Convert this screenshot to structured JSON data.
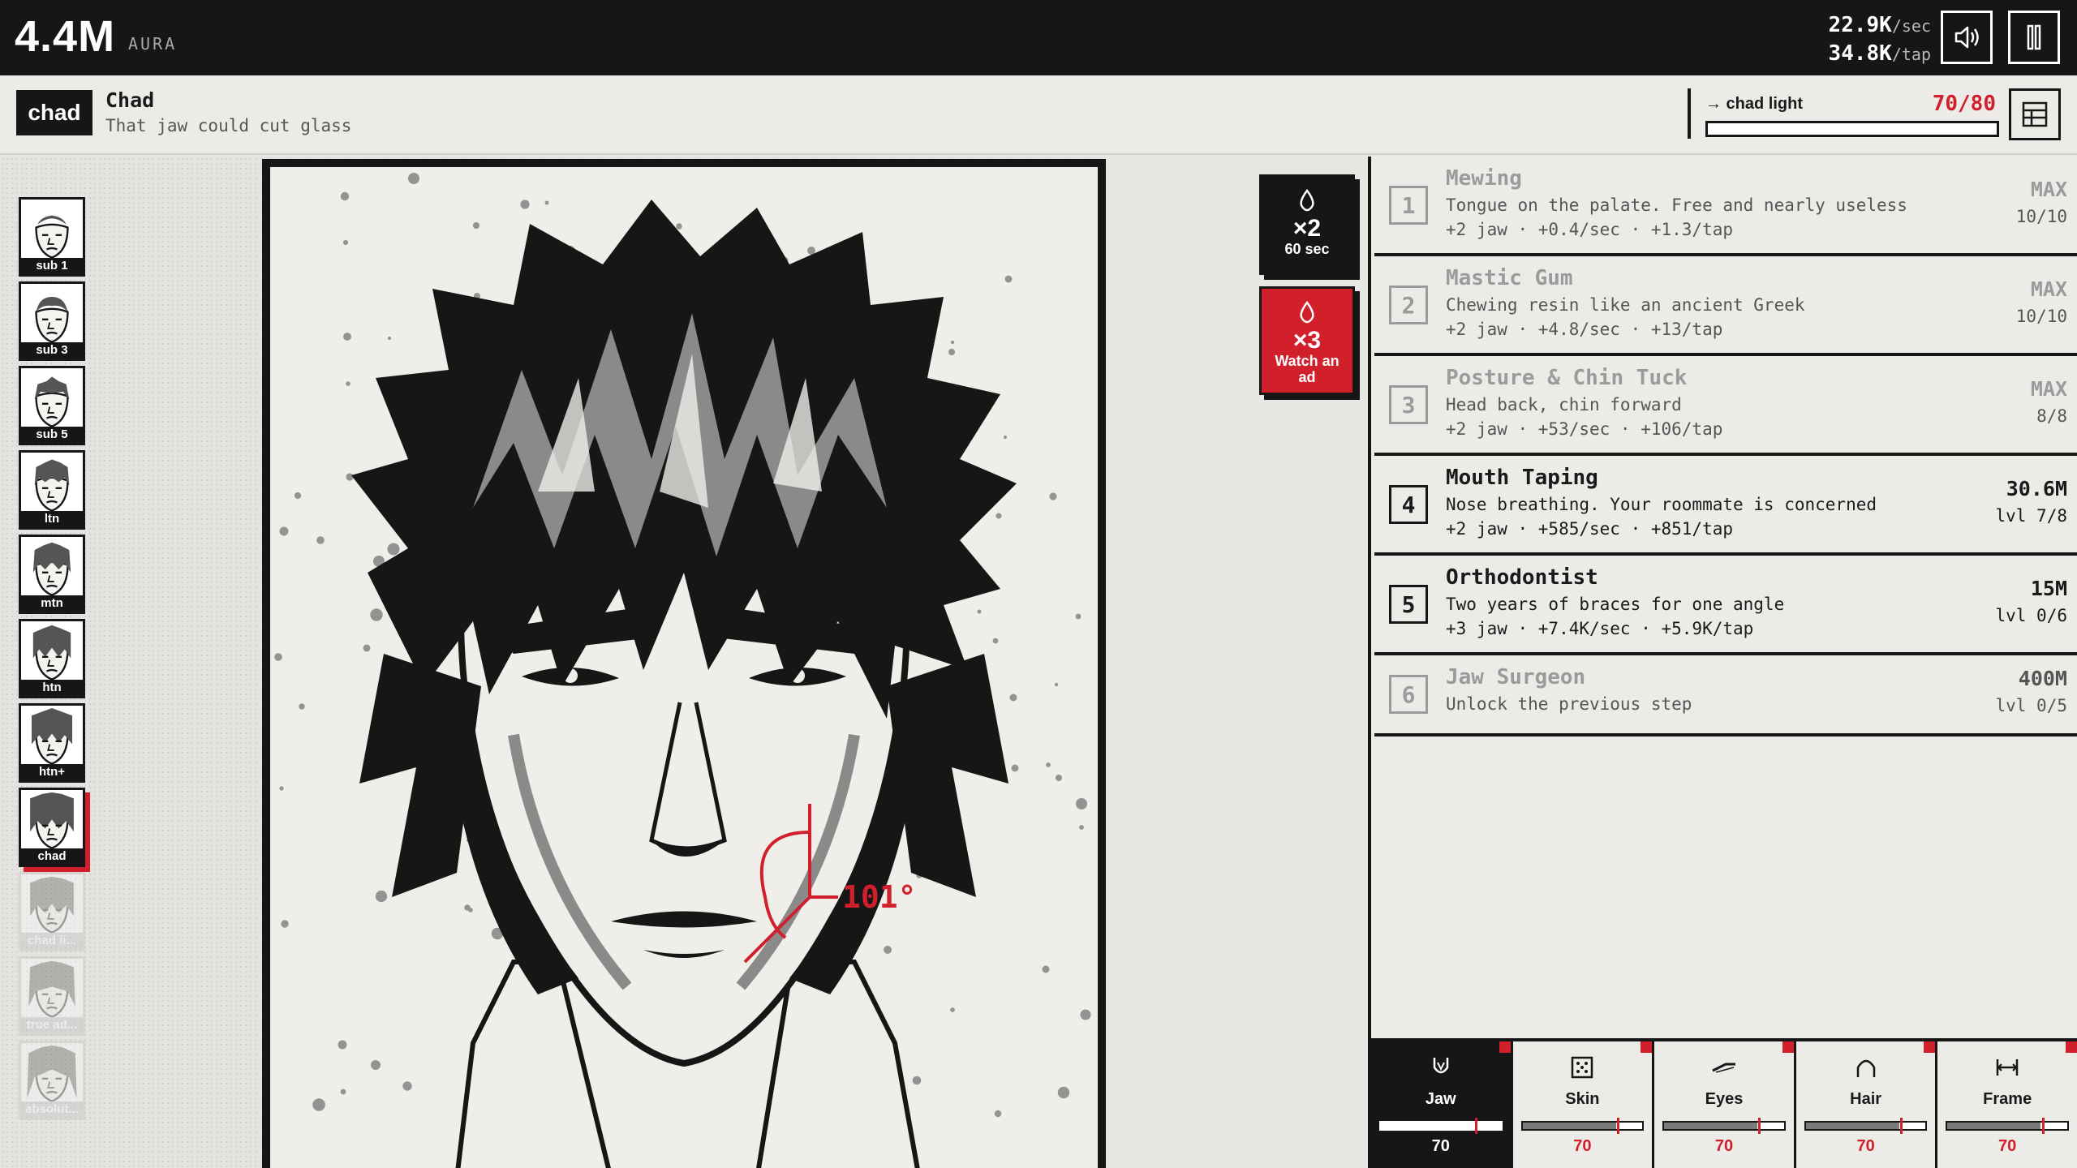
{
  "topbar": {
    "aura_value": "4.4M",
    "aura_label": "AURA",
    "per_sec_value": "22.9K",
    "per_sec_unit": "/sec",
    "per_tap_value": "34.8K",
    "per_tap_unit": "/tap",
    "sound_icon": "speaker-icon",
    "pause_icon": "pause-icon"
  },
  "level": {
    "tag": "chad",
    "name": "Chad",
    "description": "That jaw could cut glass",
    "next_label": "→ chad light",
    "next_progress": "70/80",
    "next_fraction": 0.875,
    "grid_icon": "table-icon"
  },
  "ladder": [
    {
      "caption": "sub 1",
      "state": "unlocked"
    },
    {
      "caption": "sub 3",
      "state": "unlocked"
    },
    {
      "caption": "sub 5",
      "state": "unlocked"
    },
    {
      "caption": "ltn",
      "state": "unlocked"
    },
    {
      "caption": "mtn",
      "state": "unlocked"
    },
    {
      "caption": "htn",
      "state": "unlocked"
    },
    {
      "caption": "htn+",
      "state": "unlocked"
    },
    {
      "caption": "chad",
      "state": "active"
    },
    {
      "caption": "chad li...",
      "state": "locked"
    },
    {
      "caption": "true ad...",
      "state": "locked"
    },
    {
      "caption": "absolut...",
      "state": "locked"
    }
  ],
  "portrait": {
    "angle_label": "101°"
  },
  "boosts": [
    {
      "mult": "×2",
      "label": "60 sec",
      "icon": "drop-icon"
    },
    {
      "mult": "×3",
      "label": "Watch an ad",
      "icon": "drop-icon"
    }
  ],
  "upgrades": [
    {
      "num": "1",
      "name": "Mewing",
      "desc": "Tongue on the palate. Free and nearly useless",
      "stats": "+2 jaw · +0.4/sec · +1.3/tap",
      "price": "MAX",
      "level": "10/10",
      "state": "maxed"
    },
    {
      "num": "2",
      "name": "Mastic Gum",
      "desc": "Chewing resin like an ancient Greek",
      "stats": "+2 jaw · +4.8/sec · +13/tap",
      "price": "MAX",
      "level": "10/10",
      "state": "maxed"
    },
    {
      "num": "3",
      "name": "Posture & Chin Tuck",
      "desc": "Head back, chin forward",
      "stats": "+2 jaw · +53/sec · +106/tap",
      "price": "MAX",
      "level": "8/8",
      "state": "maxed"
    },
    {
      "num": "4",
      "name": "Mouth Taping",
      "desc": "Nose breathing. Your roommate is concerned",
      "stats": "+2 jaw · +585/sec · +851/tap",
      "price": "30.6M",
      "level": "lvl 7/8",
      "state": "available"
    },
    {
      "num": "5",
      "name": "Orthodontist",
      "desc": "Two years of braces for one angle",
      "stats": "+3 jaw · +7.4K/sec · +5.9K/tap",
      "price": "15M",
      "level": "lvl 0/6",
      "state": "available"
    },
    {
      "num": "6",
      "name": "Jaw Surgeon",
      "desc": "Unlock the previous step",
      "stats": "",
      "price": "400M",
      "level": "lvl 0/5",
      "state": "locked"
    }
  ],
  "features": [
    {
      "name": "Jaw",
      "value": "70",
      "fraction": 0.78,
      "active": true,
      "icon": "jaw-icon"
    },
    {
      "name": "Skin",
      "value": "70",
      "fraction": 0.78,
      "active": false,
      "icon": "dice-icon"
    },
    {
      "name": "Eyes",
      "value": "70",
      "fraction": 0.78,
      "active": false,
      "icon": "eye-icon"
    },
    {
      "name": "Hair",
      "value": "70",
      "fraction": 0.78,
      "active": false,
      "icon": "hair-icon"
    },
    {
      "name": "Frame",
      "value": "70",
      "fraction": 0.78,
      "active": false,
      "icon": "frame-icon"
    }
  ],
  "colors": {
    "accent_red": "#d21f2c",
    "ink": "#161616",
    "paper": "#efeee8",
    "muted": "#9b9b9b"
  }
}
